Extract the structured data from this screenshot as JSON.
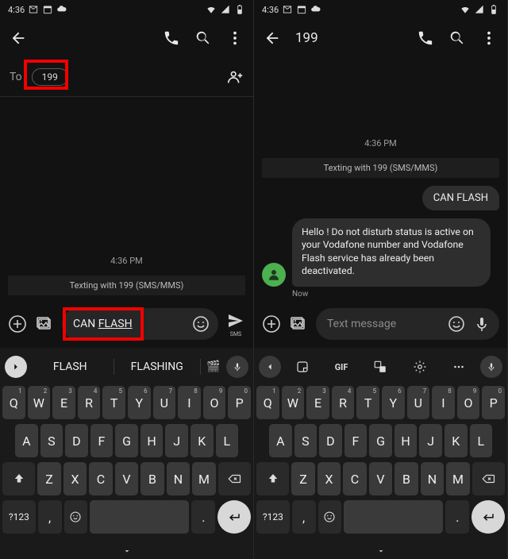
{
  "common": {
    "status_time": "4:36",
    "wifi": true,
    "signal": true,
    "battery": true
  },
  "left": {
    "to_label": "To",
    "chip": "199",
    "timestamp": "4:36 PM",
    "banner": "Texting with 199 (SMS/MMS)",
    "compose_text_pre": "CAN ",
    "compose_text_under": "FLASH",
    "send_label": "SMS",
    "suggestions": [
      "FLASH",
      "FLASHING"
    ]
  },
  "right": {
    "title": "199",
    "timestamp": "4:36 PM",
    "banner": "Texting with 199 (SMS/MMS)",
    "out_msg": "CAN FLASH",
    "in_msg": "Hello ! Do not disturb status is  active on your Vodafone number and Vodafone Flash service has already been deactivated.",
    "in_ts": "Now",
    "placeholder": "Text message"
  },
  "keyboard": {
    "row1": [
      [
        "Q",
        "1"
      ],
      [
        "W",
        "2"
      ],
      [
        "E",
        "3"
      ],
      [
        "R",
        "4"
      ],
      [
        "T",
        "5"
      ],
      [
        "Y",
        "6"
      ],
      [
        "U",
        "7"
      ],
      [
        "I",
        "8"
      ],
      [
        "O",
        "9"
      ],
      [
        "P",
        "0"
      ]
    ],
    "row2": [
      "A",
      "S",
      "D",
      "F",
      "G",
      "H",
      "J",
      "K",
      "L"
    ],
    "row3": [
      "Z",
      "X",
      "C",
      "V",
      "B",
      "N",
      "M"
    ],
    "numkey": "?123",
    "comma": ",",
    "period": "."
  }
}
